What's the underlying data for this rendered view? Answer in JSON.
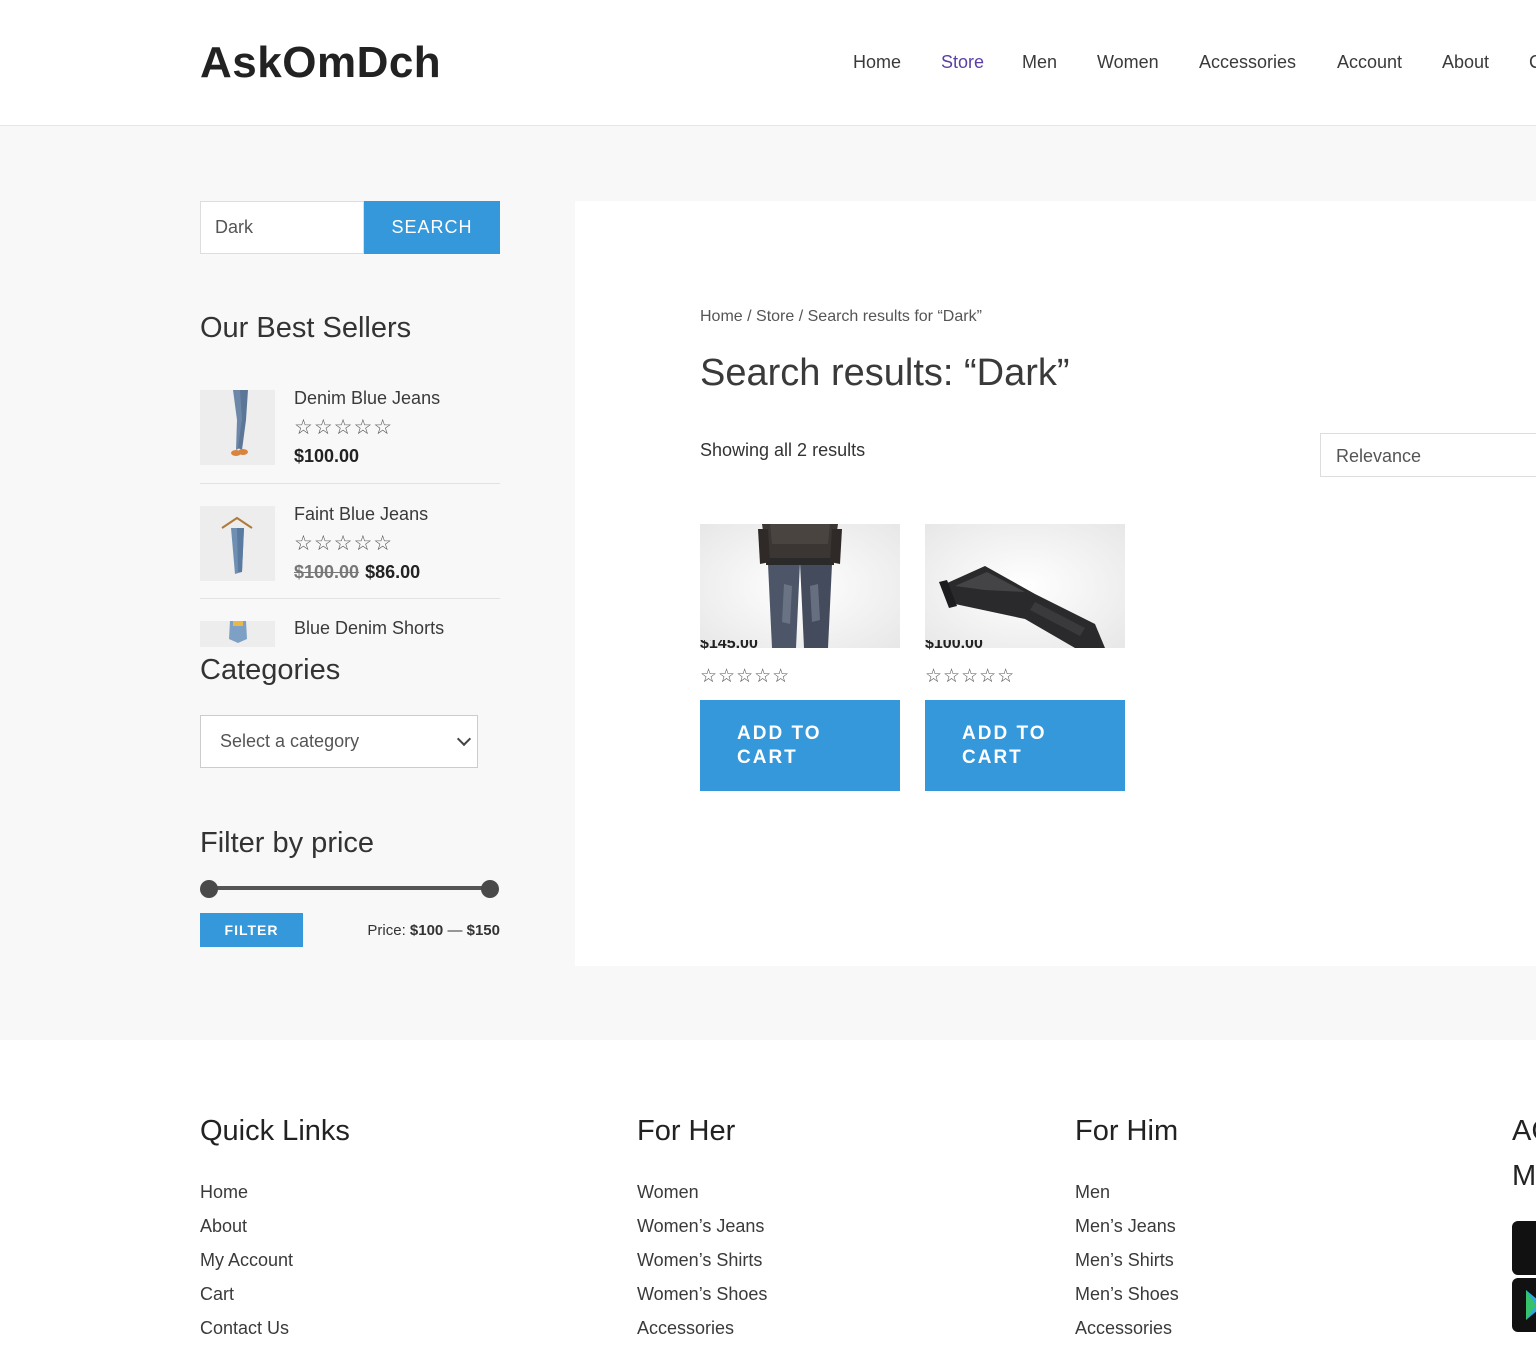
{
  "site": {
    "logo": "AskOmDch"
  },
  "nav": [
    "Home",
    "Store",
    "Men",
    "Women",
    "Accessories",
    "Account",
    "About",
    "C"
  ],
  "sidebar": {
    "search": {
      "value": "Dark",
      "button": "SEARCH"
    },
    "best_sellers_title": "Our Best Sellers",
    "best_sellers": [
      {
        "name": "Denim Blue Jeans",
        "stars": "☆☆☆☆☆",
        "price": "$100.00",
        "old_price": ""
      },
      {
        "name": "Faint Blue Jeans",
        "stars": "☆☆☆☆☆",
        "price": "$86.00",
        "old_price": "$100.00"
      },
      {
        "name": "Blue Denim Shorts"
      }
    ],
    "categories_title": "Categories",
    "category_select": "Select a category",
    "filter_title": "Filter by price",
    "filter_button": "FILTER",
    "price_prefix": "Price:",
    "price_min": "$100",
    "price_sep": "—",
    "price_max": "$150"
  },
  "content": {
    "breadcrumb": {
      "home": "Home",
      "store": "Store",
      "current": "Search results for “Dark”"
    },
    "title": "Search results: “Dark”",
    "result_count": "Showing all 2 results",
    "orderby": "Relevance",
    "products": [
      {
        "price": "$145.00",
        "stars": "☆☆☆☆☆",
        "button": "ADD TO CART"
      },
      {
        "price": "$100.00",
        "stars": "☆☆☆☆☆",
        "button": "ADD TO CART"
      }
    ]
  },
  "footer": {
    "quick_links": {
      "title": "Quick Links",
      "links": [
        "Home",
        "About",
        "My Account",
        "Cart",
        "Contact Us"
      ]
    },
    "for_her": {
      "title": "For Her",
      "links": [
        "Women",
        "Women’s Jeans",
        "Women’s Shirts",
        "Women’s Shoes",
        "Accessories"
      ]
    },
    "for_him": {
      "title": "For Him",
      "links": [
        "Men",
        "Men’s Jeans",
        "Men’s Shirts",
        "Men’s Shoes",
        "Accessories"
      ]
    },
    "cut_title": [
      "AC",
      "M"
    ]
  },
  "colors": {
    "accent": "#3498db",
    "active_nav": "#5a3fa6",
    "background": "#f8f8f8"
  }
}
